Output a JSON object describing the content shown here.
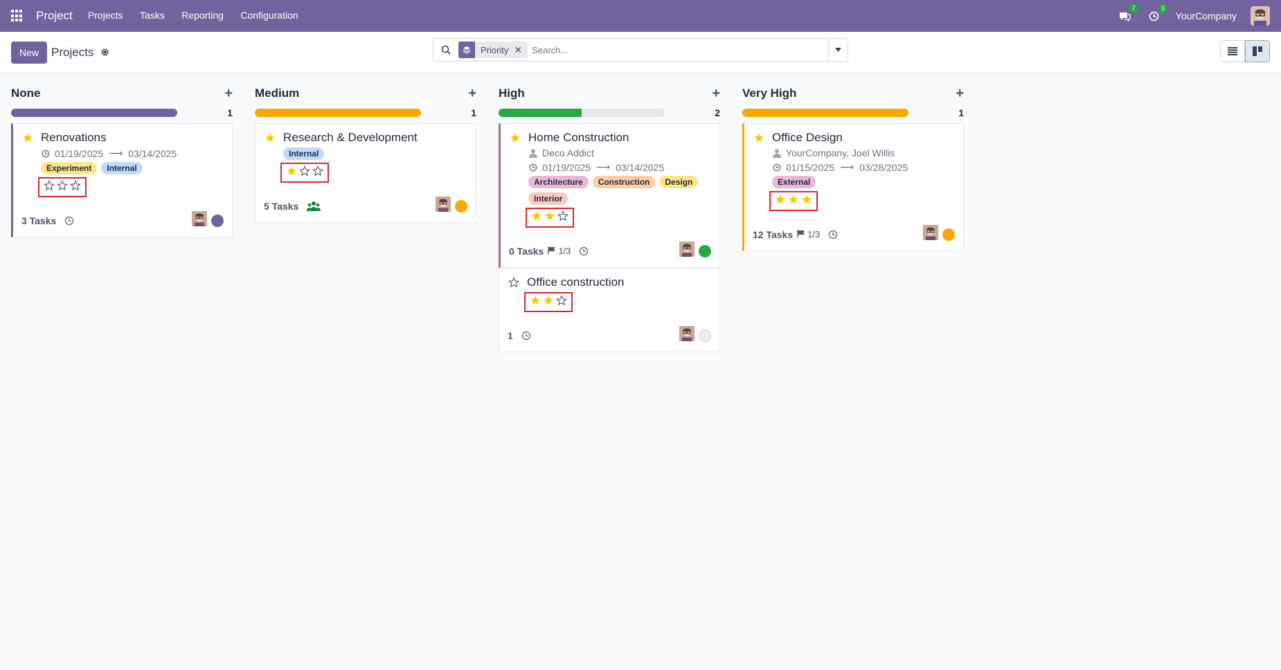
{
  "navbar": {
    "brand": "Project",
    "menu": [
      "Projects",
      "Tasks",
      "Reporting",
      "Configuration"
    ],
    "messages_count": "7",
    "activities_count": "3",
    "company": "YourCompany"
  },
  "control": {
    "new_label": "New",
    "title": "Projects",
    "facet_label": "Priority",
    "search_placeholder": "Search..."
  },
  "colors": {
    "brand": "#71639e",
    "orange": "#f7a800",
    "green": "#28a745",
    "star": "#f3cc00"
  },
  "columns": [
    {
      "title": "None",
      "count": "1",
      "progress": [
        {
          "color": "#71639e",
          "pct": 100
        }
      ],
      "cards": [
        {
          "title": "Renovations",
          "favorite": true,
          "customer": "",
          "date_start": "01/19/2025",
          "date_end": "03/14/2025",
          "tags": [
            {
              "label": "Experiment",
              "color": "#fde68a"
            },
            {
              "label": "Internal",
              "color": "#bfdbfe"
            }
          ],
          "priority": 0,
          "tasks": "3 Tasks",
          "milestone": "",
          "footer_icon": "clock-icon",
          "status_color": "#71639e",
          "border": "#71639e"
        }
      ]
    },
    {
      "title": "Medium",
      "count": "1",
      "progress": [
        {
          "color": "#f7a800",
          "pct": 100
        }
      ],
      "cards": [
        {
          "title": "Research & Development",
          "favorite": true,
          "customer": "",
          "date_start": "",
          "date_end": "",
          "tags": [
            {
              "label": "Internal",
              "color": "#bfdbfe"
            }
          ],
          "priority": 1,
          "tasks": "5 Tasks",
          "milestone": "",
          "footer_icon": "users-icon",
          "status_color": "#f7a800",
          "border": ""
        }
      ]
    },
    {
      "title": "High",
      "count": "2",
      "progress": [
        {
          "color": "#28a745",
          "pct": 50
        }
      ],
      "cards": [
        {
          "title": "Home Construction",
          "favorite": true,
          "customer": "Deco Addict",
          "date_start": "01/19/2025",
          "date_end": "03/14/2025",
          "tags": [
            {
              "label": "Architecture",
              "color": "#e9b8d8"
            },
            {
              "label": "Construction",
              "color": "#fbcfa5"
            },
            {
              "label": "Design",
              "color": "#fde68a"
            },
            {
              "label": "Interior",
              "color": "#fbc9c0"
            }
          ],
          "priority": 2,
          "tasks": "0 Tasks",
          "milestone": "1/3",
          "footer_icon": "clock-icon",
          "status_color": "#28a745",
          "border": "#a66a9e"
        },
        {
          "title": "Office construction",
          "favorite": false,
          "customer": "",
          "date_start": "",
          "date_end": "",
          "tags": [],
          "priority": 2,
          "tasks": "1",
          "milestone": "",
          "footer_icon": "clock-icon",
          "status_color": "#eeeeee",
          "border": ""
        }
      ]
    },
    {
      "title": "Very High",
      "count": "1",
      "progress": [
        {
          "color": "#f7a800",
          "pct": 100
        }
      ],
      "cards": [
        {
          "title": "Office Design",
          "favorite": true,
          "customer": "YourCompany, Joel Willis",
          "date_start": "01/15/2025",
          "date_end": "03/28/2025",
          "tags": [
            {
              "label": "External",
              "color": "#e9b8d8"
            }
          ],
          "priority": 3,
          "tasks": "12 Tasks",
          "milestone": "1/3",
          "footer_icon": "clock-icon",
          "status_color": "#f7a800",
          "border": "#f7a800"
        }
      ]
    }
  ]
}
